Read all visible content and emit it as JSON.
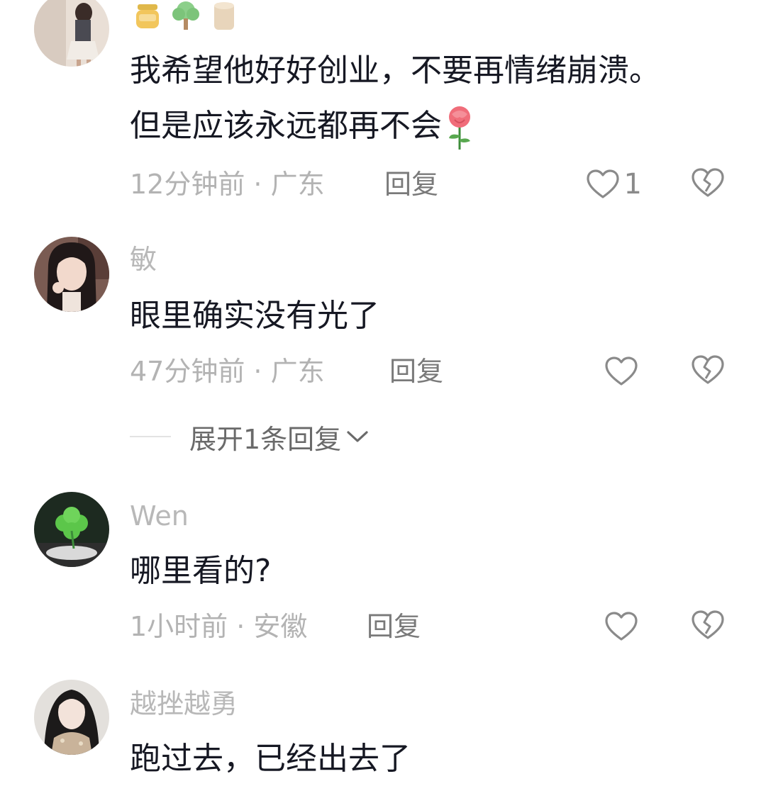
{
  "comments": [
    {
      "username": "",
      "reaction_icons": [
        "honey-jar-icon",
        "tree-icon",
        "log-icon"
      ],
      "lines": [
        "我希望他好好创业，不要再情绪崩溃。",
        "但是应该永远都再不会"
      ],
      "inline_emoji": "rose-icon",
      "time_location": "12分钟前 · 广东",
      "reply_label": "回复",
      "like_count": "1"
    },
    {
      "username": "敏",
      "lines": [
        "眼里确实没有光了"
      ],
      "time_location": "47分钟前 · 广东",
      "reply_label": "回复",
      "like_count": ""
    },
    {
      "username": "Wen",
      "lines": [
        "哪里看的?"
      ],
      "time_location": "1小时前 · 安徽",
      "reply_label": "回复",
      "like_count": ""
    },
    {
      "username": "越挫越勇",
      "lines": [
        "跑过去，已经出去了"
      ]
    }
  ],
  "expand_replies_label": "展开1条回复",
  "colors": {
    "background": "#ffffff",
    "text": "#161823",
    "meta": "#b3b3b3",
    "icon": "#8a8a8a"
  }
}
